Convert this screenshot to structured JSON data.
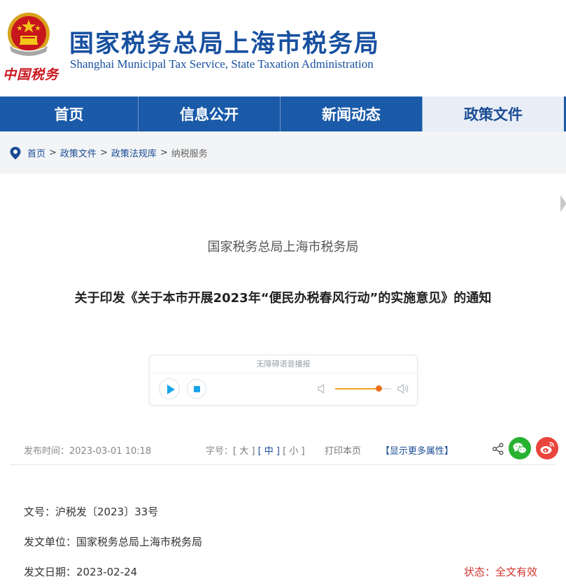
{
  "header": {
    "title_cn": "国家税务总局上海市税务局",
    "title_en": "Shanghai Municipal Tax Service, State Taxation Administration",
    "brand_script": "中国税务"
  },
  "nav": {
    "items": [
      {
        "label": "首页"
      },
      {
        "label": "信息公开"
      },
      {
        "label": "新闻动态"
      },
      {
        "label": "政策文件",
        "active": true
      }
    ]
  },
  "breadcrumb": {
    "items": [
      "首页",
      "政策文件",
      "政策法规库"
    ],
    "current": "纳税服务",
    "separator": ">"
  },
  "article": {
    "issuer": "国家税务总局上海市税务局",
    "title": "关于印发《关于本市开展2023年“便民办税春风行动”的实施意见》的通知"
  },
  "player": {
    "label": "无障碍语音播报",
    "volume_percent": 77
  },
  "meta": {
    "publish_label": "发布时间：",
    "publish_time": "2023-03-01 10:18",
    "font_size_label": "字号：",
    "font_large": "[ 大 ]",
    "font_medium": "[ 中 ]",
    "font_small": "[ 小 ]",
    "print_label": "打印本页",
    "more_label": "【显示更多属性】"
  },
  "properties": {
    "doc_no_label": "文号：",
    "doc_no": "沪税发〔2023〕33号",
    "issuer_label": "发文单位：",
    "issuer": "国家税务总局上海市税务局",
    "date_label": "发文日期：",
    "date": "2023-02-24",
    "status_label": "状态：",
    "status": "全文有效"
  },
  "colors": {
    "brand_blue": "#1a5aa8",
    "link_blue": "#1a4c94",
    "status_red": "#d0352c",
    "wechat_green": "#28b232",
    "weibo_red": "#e9453d"
  },
  "icons": [
    "national-emblem-icon",
    "location-pin-icon",
    "play-icon",
    "stop-icon",
    "volume-low-icon",
    "volume-high-icon",
    "share-icon",
    "wechat-icon",
    "weibo-icon"
  ]
}
